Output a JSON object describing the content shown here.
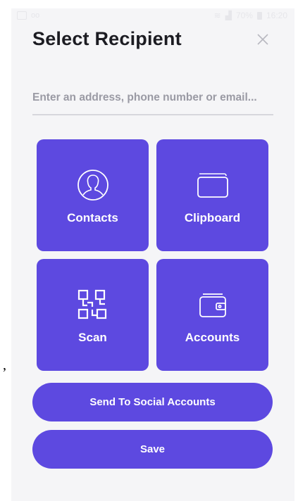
{
  "status_bar": {
    "battery": "70%",
    "time": "16:20"
  },
  "header": {
    "title": "Select Recipient",
    "close_icon": "close-icon"
  },
  "recipient_input": {
    "placeholder": "Enter an address, phone number or email...",
    "value": ""
  },
  "tiles": [
    {
      "label": "Contacts",
      "icon": "contact-avatar-icon"
    },
    {
      "label": "Clipboard",
      "icon": "clipboard-icon"
    },
    {
      "label": "Scan",
      "icon": "qr-scan-icon"
    },
    {
      "label": "Accounts",
      "icon": "wallet-icon"
    }
  ],
  "actions": {
    "social_label": "Send To Social Accounts",
    "save_label": "Save"
  },
  "colors": {
    "accent": "#5d49e0",
    "background": "#f5f5f7",
    "text": "#1c1c22"
  },
  "page_fragment": ","
}
